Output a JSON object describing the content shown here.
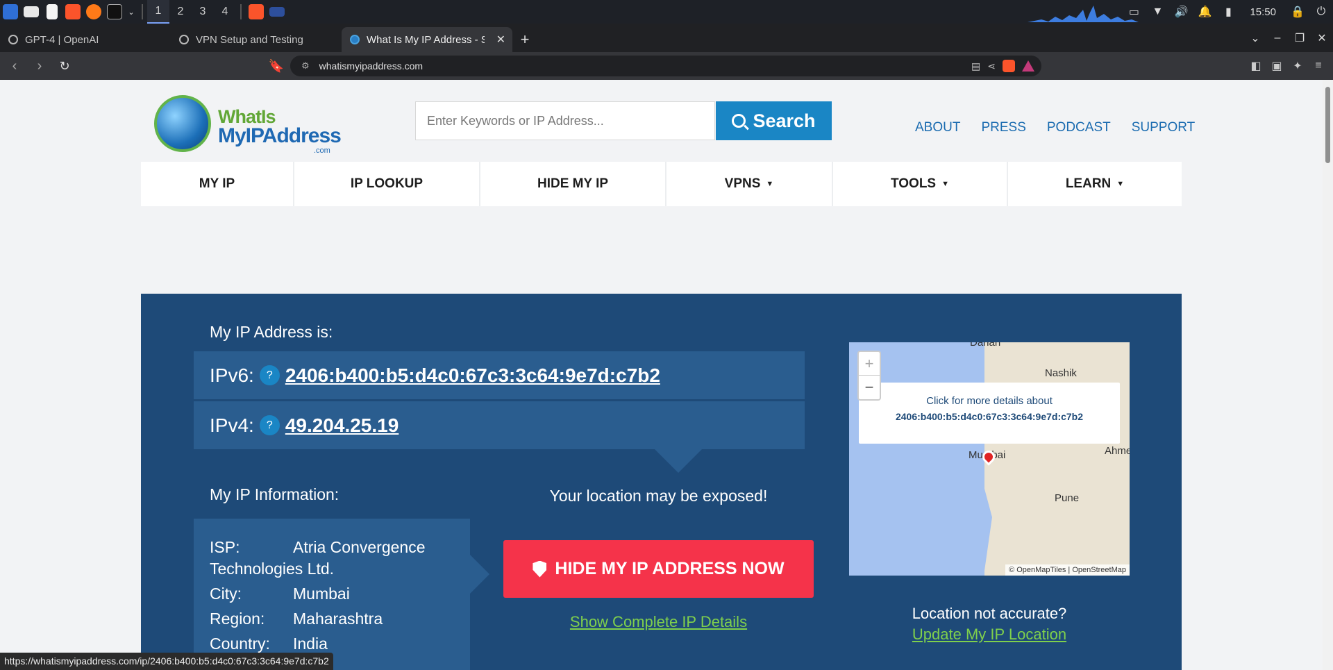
{
  "taskbar": {
    "workspaces": [
      "1",
      "2",
      "3",
      "4"
    ],
    "clock": "15:50"
  },
  "tabs": [
    {
      "label": "GPT-4 | OpenAI"
    },
    {
      "label": "VPN Setup and Testing"
    },
    {
      "label": "What Is My IP Address - Se"
    }
  ],
  "address_bar": {
    "url": "whatismyipaddress.com"
  },
  "site": {
    "logo": {
      "line1": "WhatIs",
      "line2": "MyIPAddress",
      "line3": ".com"
    },
    "search": {
      "placeholder": "Enter Keywords or IP Address...",
      "button": "Search"
    },
    "toplinks": [
      "ABOUT",
      "PRESS",
      "PODCAST",
      "SUPPORT"
    ],
    "nav": [
      "MY IP",
      "IP LOOKUP",
      "HIDE MY IP",
      "VPNS",
      "TOOLS",
      "LEARN"
    ],
    "hero": {
      "heading": "My IP Address is:",
      "ipv6_label": "IPv6:",
      "ipv6": "2406:b400:b5:d4c0:67c3:3c64:9e7d:c7b2",
      "ipv4_label": "IPv4:",
      "ipv4": "49.204.25.19",
      "info_heading": "My IP Information:",
      "info": {
        "isp_label": "ISP:",
        "isp_line1": "Atria Convergence",
        "isp_line2": "Technologies Ltd.",
        "city_label": "City:",
        "city": "Mumbai",
        "region_label": "Region:",
        "region": "Maharashtra",
        "country_label": "Country:",
        "country": "India"
      },
      "exposed": "Your location may be exposed!",
      "hide_button": "HIDE MY IP ADDRESS NOW",
      "show_details": "Show Complete IP Details",
      "map": {
        "popup_line1": "Click for more details about",
        "popup_line2": "2406:b400:b5:d4c0:67c3:3c64:9e7d:c7b2",
        "cities": [
          "Dahan",
          "Nashik",
          "Mumbai",
          "Ahme",
          "Pune"
        ],
        "attribution": "© OpenMapTiles | OpenStreetMap"
      },
      "not_accurate": "Location not accurate?",
      "update_location": "Update My IP Location"
    }
  },
  "status_url": "https://whatismyipaddress.com/ip/2406:b400:b5:d4c0:67c3:3c64:9e7d:c7b2"
}
